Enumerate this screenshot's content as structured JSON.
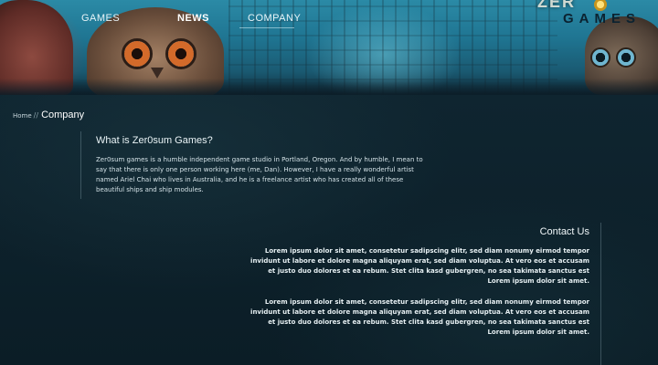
{
  "nav": {
    "items": [
      {
        "label": "GAMES"
      },
      {
        "label": "NEWS",
        "active": true
      },
      {
        "label": "COMPANY"
      }
    ]
  },
  "logo": {
    "top_text": "ZER",
    "bottom_text": "GAMES"
  },
  "breadcrumb": {
    "home": "Home",
    "separator": "//",
    "current": "Company"
  },
  "about": {
    "title": "What is Zer0sum Games?",
    "body": "Zer0sum games is a humble independent game studio in Portland, Oregon. And by humble, I mean to say that there is only one person working here (me, Dan). However, I have a really wonderful artist named Ariel Chai who lives in Australia, and he is a freelance artist who has created all of these beautiful ships and ship modules."
  },
  "contact": {
    "title": "Contact Us",
    "paragraphs": [
      "Lorem ipsum dolor sit amet, consetetur sadipscing elitr, sed diam nonumy eirmod tempor invidunt ut labore et dolore magna aliquyam erat, sed diam voluptua. At vero eos et accusam et justo duo dolores et ea rebum. Stet clita kasd gubergren, no sea takimata sanctus est Lorem ipsum dolor sit amet.",
      "Lorem ipsum dolor sit amet, consetetur sadipscing elitr, sed diam nonumy eirmod tempor invidunt ut labore et dolore magna aliquyam erat, sed diam voluptua. At vero eos et accusam et justo duo dolores et ea rebum. Stet clita kasd gubergren, no sea takimata sanctus est Lorem ipsum dolor sit amet."
    ]
  },
  "colors": {
    "background": "#0c1c26",
    "banner": "#2b8aa6",
    "text": "#d8e6ec"
  }
}
